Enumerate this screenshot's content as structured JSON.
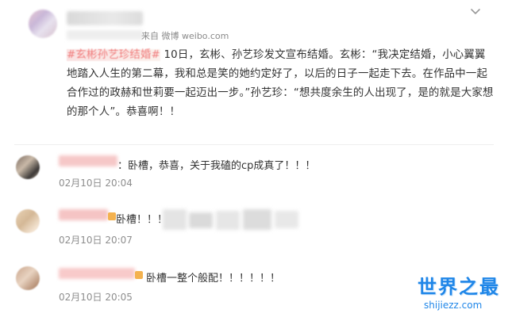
{
  "post": {
    "source_prefix": "来自",
    "source_name": "微博",
    "source_site": "weibo.com",
    "hashtag": "#玄彬孙艺珍结婚#",
    "body": " 10日，玄彬、孙艺珍发文宣布结婚。玄彬：“我决定结婚，小心翼翼地踏入人生的第二幕，我和总是笑的她约定好了，以后的日子一起走下去。在作品中一起合作过的政赫和世莉要一起迈出一步。”孙艺珍：“想共度余生的人出现了，是的就是大家想的那个人”。恭喜啊！！"
  },
  "comments": [
    {
      "text": "：卧槽，恭喜，关于我磕的cp成真了！！！",
      "time": "02月10日 20:04"
    },
    {
      "text": "卧槽！！！",
      "time": "02月10日 20:07"
    },
    {
      "text": "卧槽一整个般配！！！！！！",
      "time": "02月10日 20:05"
    }
  ],
  "watermark": {
    "title": "世界之最",
    "domain": "shijiezz.com"
  },
  "colors": {
    "hashtag": "#f07b7b",
    "watermark": "#1f86e8",
    "badge": "#f4b24f",
    "time": "#8e8e8e"
  },
  "icons": {
    "menu": "chevron-down-icon"
  }
}
